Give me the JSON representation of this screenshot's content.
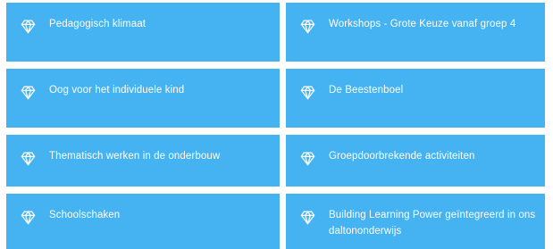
{
  "tiles": [
    {
      "label": "Pedagogisch klimaat",
      "icon": "diamond-icon"
    },
    {
      "label": "Workshops - Grote Keuze vanaf groep 4",
      "icon": "diamond-icon"
    },
    {
      "label": "Oog voor het individuele kind",
      "icon": "diamond-icon"
    },
    {
      "label": "De Beestenboel",
      "icon": "diamond-icon"
    },
    {
      "label": "Thematisch werken in de onderbouw",
      "icon": "diamond-icon"
    },
    {
      "label": "Groepdoorbrekende activiteiten",
      "icon": "diamond-icon"
    },
    {
      "label": "Schoolschaken",
      "icon": "diamond-icon"
    },
    {
      "label": "Building Learning Power geïntegreerd in ons daltononderwijs",
      "icon": "diamond-icon"
    }
  ],
  "colors": {
    "tile_background": "#45b3f2",
    "tile_text": "#ffffff",
    "page_background": "#ffffff"
  }
}
